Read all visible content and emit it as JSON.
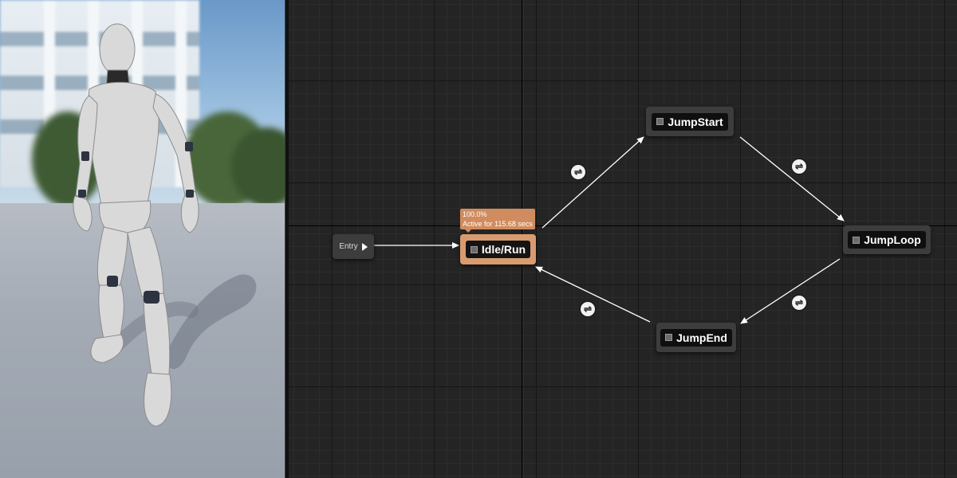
{
  "viewport": {
    "colors": {
      "sky": "#9cc0e0",
      "floor": "#a4abb5",
      "mannequin": "#d8d8d8"
    }
  },
  "graph": {
    "entry": {
      "label": "Entry"
    },
    "active_tooltip": {
      "weight": "100.0%",
      "active_time": "Active for 115.68 secs"
    },
    "states": {
      "idle_run": "Idle/Run",
      "jump_start": "JumpStart",
      "jump_loop": "JumpLoop",
      "jump_end": "JumpEnd"
    },
    "transition_icon": "⇌",
    "colors": {
      "active_state": "#d89b6f",
      "node": "#3d3d3d",
      "wire": "#ffffff",
      "tooltip": "#d08c5e"
    }
  }
}
